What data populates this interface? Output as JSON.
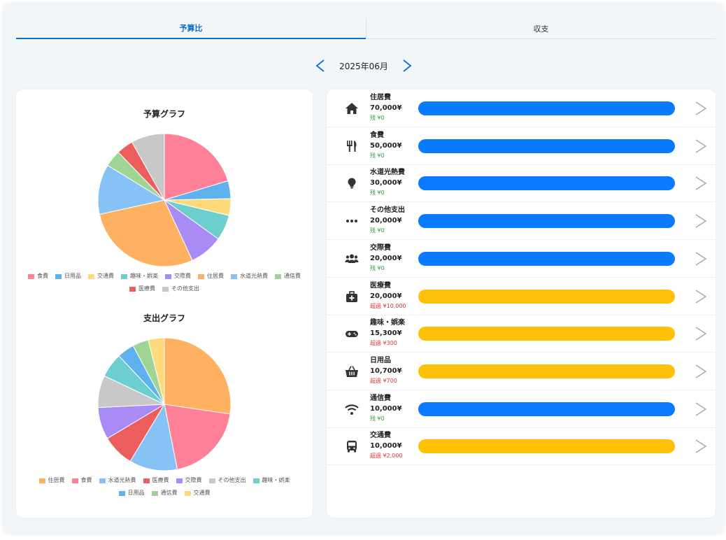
{
  "tabs": [
    {
      "label": "予算比",
      "active": true
    },
    {
      "label": "収支",
      "active": false
    }
  ],
  "month_nav": {
    "label": "2025年06月",
    "prev_icon": "chevron-left-icon",
    "next_icon": "chevron-right-icon"
  },
  "colors": {
    "accent": "#0a6ed1",
    "bar_ok": "#0a7bff",
    "bar_over": "#ffc107",
    "remain_ok": "#2e9a3a",
    "remain_over": "#d33333"
  },
  "chart_data": [
    {
      "type": "pie",
      "title": "予算グラフ",
      "legend_position": "bottom",
      "labels": [
        "食費",
        "日用品",
        "交通費",
        "趣味・娯楽",
        "交際費",
        "住居費",
        "水道光熱費",
        "通信費",
        "医療費",
        "その他支出"
      ],
      "values": [
        50000,
        10700,
        10000,
        15300,
        20000,
        70000,
        30000,
        10000,
        10000,
        20000
      ],
      "colors": [
        "#ff8198",
        "#5eb1ec",
        "#ffd97a",
        "#6ccfcd",
        "#a98bf6",
        "#ffb162",
        "#86c3f4",
        "#9fd594",
        "#ec5d5d",
        "#c8c8c8"
      ]
    },
    {
      "type": "pie",
      "title": "支出グラフ",
      "legend_position": "bottom",
      "labels": [
        "住居費",
        "食費",
        "水道光熱費",
        "医療費",
        "交際費",
        "その他支出",
        "趣味・娯楽",
        "日用品",
        "通信費",
        "交通費"
      ],
      "values": [
        70000,
        50000,
        30000,
        20000,
        20000,
        20000,
        15300,
        10700,
        10000,
        10000
      ],
      "colors": [
        "#ffb162",
        "#ff8198",
        "#86c3f4",
        "#ec5d5d",
        "#a98bf6",
        "#c8c8c8",
        "#6ccfcd",
        "#5eb1ec",
        "#9fd594",
        "#ffd97a"
      ]
    }
  ],
  "categories": [
    {
      "icon": "house-icon",
      "name": "住居費",
      "amount": "70,000¥",
      "remain": "残 ¥0",
      "over": false,
      "progress": 1.0
    },
    {
      "icon": "fork-knife-icon",
      "name": "食費",
      "amount": "50,000¥",
      "remain": "残 ¥0",
      "over": false,
      "progress": 1.0
    },
    {
      "icon": "lightbulb-icon",
      "name": "水道光熱費",
      "amount": "30,000¥",
      "remain": "残 ¥0",
      "over": false,
      "progress": 1.0
    },
    {
      "icon": "ellipsis-icon",
      "name": "その他支出",
      "amount": "20,000¥",
      "remain": "残 ¥0",
      "over": false,
      "progress": 1.0
    },
    {
      "icon": "users-icon",
      "name": "交際費",
      "amount": "20,000¥",
      "remain": "残 ¥0",
      "over": false,
      "progress": 1.0
    },
    {
      "icon": "medical-kit-icon",
      "name": "医療費",
      "amount": "20,000¥",
      "remain": "超過 ¥10,000",
      "over": true,
      "progress": 1.0
    },
    {
      "icon": "gamepad-icon",
      "name": "趣味・娯楽",
      "amount": "15,300¥",
      "remain": "超過 ¥300",
      "over": true,
      "progress": 1.0
    },
    {
      "icon": "basket-icon",
      "name": "日用品",
      "amount": "10,700¥",
      "remain": "超過 ¥700",
      "over": true,
      "progress": 1.0
    },
    {
      "icon": "wifi-icon",
      "name": "通信費",
      "amount": "10,000¥",
      "remain": "残 ¥0",
      "over": false,
      "progress": 1.0
    },
    {
      "icon": "bus-icon",
      "name": "交通費",
      "amount": "10,000¥",
      "remain": "超過 ¥2,000",
      "over": true,
      "progress": 1.0
    }
  ]
}
